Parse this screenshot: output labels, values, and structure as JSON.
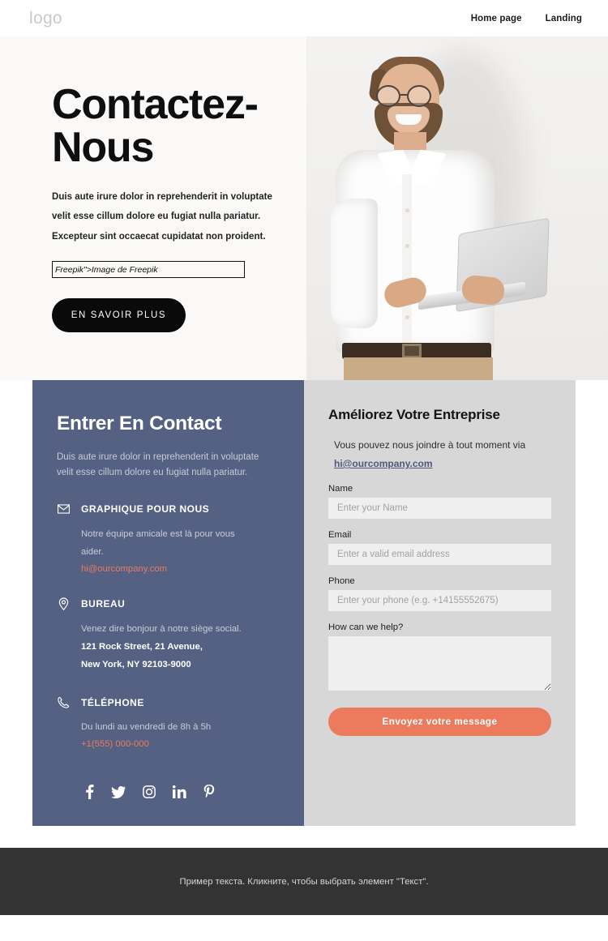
{
  "header": {
    "logo": "logo",
    "nav": [
      {
        "label": "Home page"
      },
      {
        "label": "Landing"
      }
    ]
  },
  "hero": {
    "title": "Contactez-Nous",
    "paragraphs": [
      "Duis aute irure dolor in reprehenderit in voluptate",
      "velit esse cillum dolore eu fugiat nulla pariatur.",
      "Excepteur sint occaecat cupidatat non proident."
    ],
    "credit": "Freepik\">Image de Freepik",
    "cta_label": "EN SAVOIR PLUS",
    "image_alt": "smiling-businessman-with-glasses-holding-laptop"
  },
  "contact": {
    "left": {
      "title": "Entrer En Contact",
      "subtitle": "Duis aute irure dolor in reprehenderit in voluptate velit esse cillum dolore eu fugiat nulla pariatur.",
      "blocks": [
        {
          "icon": "envelope-icon",
          "title": "GRAPHIQUE POUR NOUS",
          "lines": [
            "Notre équipe amicale est là pour vous",
            "aider."
          ],
          "link": "hi@ourcompany.com"
        },
        {
          "icon": "map-pin-icon",
          "title": "BUREAU",
          "lines": [
            "Venez dire bonjour à notre siège social."
          ],
          "strong_lines": [
            "121 Rock Street, 21 Avenue,",
            "New York, NY 92103-9000"
          ]
        },
        {
          "icon": "phone-icon",
          "title": "TÉLÉPHONE",
          "lines": [
            "Du lundi au vendredi de 8h à 5h"
          ],
          "link": "+1(555) 000-000"
        }
      ],
      "socials": [
        {
          "name": "facebook-icon",
          "glyph": "f"
        },
        {
          "name": "twitter-icon",
          "glyph": "t"
        },
        {
          "name": "instagram-icon",
          "glyph": "i"
        },
        {
          "name": "linkedin-icon",
          "glyph": "in"
        },
        {
          "name": "pinterest-icon",
          "glyph": "P"
        }
      ]
    },
    "form": {
      "title": "Améliorez Votre Entreprise",
      "intro": "Vous pouvez nous joindre à tout moment via",
      "intro_link": "hi@ourcompany.com",
      "fields": [
        {
          "label": "Name",
          "placeholder": "Enter your Name",
          "value": ""
        },
        {
          "label": "Email",
          "placeholder": "Enter a valid email address",
          "value": ""
        },
        {
          "label": "Phone",
          "placeholder": "Enter your phone (e.g. +14155552675)",
          "value": ""
        }
      ],
      "message_label": "How can we help?",
      "message_placeholder": "",
      "message_value": "",
      "submit_label": "Envoyez votre message"
    }
  },
  "footer": {
    "text": "Пример текста. Кликните, чтобы выбрать элемент \"Текст\"."
  },
  "colors": {
    "slate_panel": "#546183",
    "coral_accent": "#ec7a5c",
    "right_panel": "#d7d7d7",
    "hero_bg": "#faf9f7",
    "footer_bg": "#333333",
    "link_blue": "#4d5a79"
  }
}
